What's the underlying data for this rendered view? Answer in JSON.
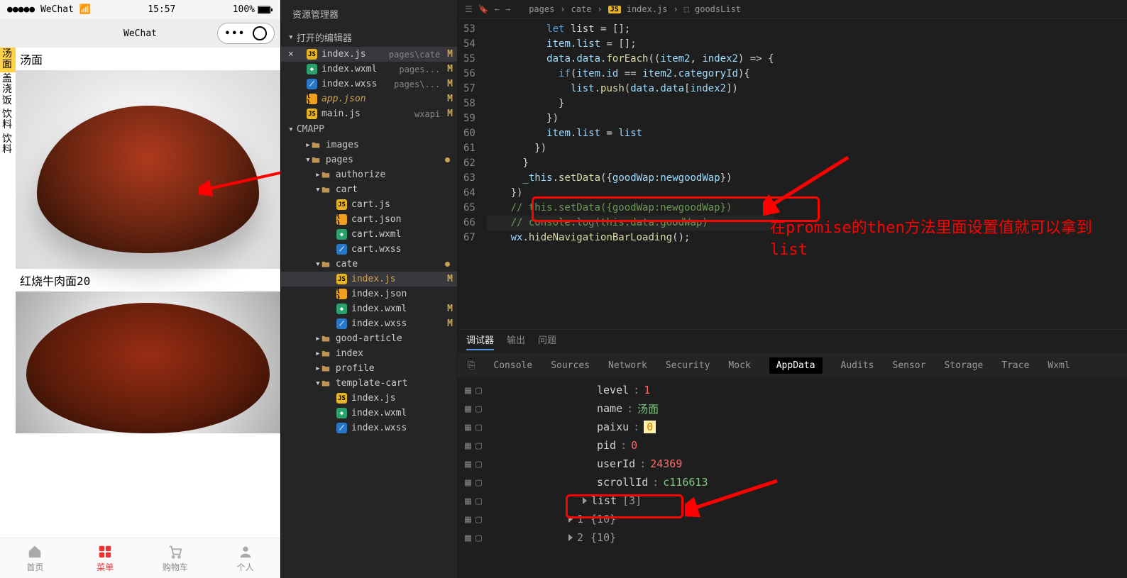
{
  "phone": {
    "carrier": "WeChat",
    "time": "15:57",
    "battery": "100%",
    "navTitle": "WeChat",
    "sideSelected": "汤面",
    "sideItems": [
      "盖浇饭",
      "饮料",
      "饮料"
    ],
    "food1": "汤面",
    "food2": "红烧牛肉面20",
    "tabs": [
      {
        "label": "首页",
        "icon": "home"
      },
      {
        "label": "菜单",
        "icon": "grid",
        "active": true
      },
      {
        "label": "购物车",
        "icon": "cart"
      },
      {
        "label": "个人",
        "icon": "user"
      }
    ]
  },
  "explorer": {
    "title": "资源管理器",
    "openEditors": "打开的编辑器",
    "openFiles": [
      {
        "name": "index.js",
        "suf": "pages\\cate",
        "mod": "M",
        "icon": "js",
        "active": true
      },
      {
        "name": "index.wxml",
        "suf": "pages...",
        "mod": "M",
        "icon": "wxml"
      },
      {
        "name": "index.wxss",
        "suf": "pages\\...",
        "mod": "M",
        "icon": "wxss"
      },
      {
        "name": "app.json",
        "suf": "",
        "mod": "M",
        "icon": "json",
        "italic": true
      },
      {
        "name": "main.js",
        "suf": "wxapi",
        "mod": "M",
        "icon": "js"
      }
    ],
    "project": "CMAPP",
    "tree": [
      {
        "type": "fold",
        "name": "images",
        "depth": 1
      },
      {
        "type": "fold",
        "name": "pages",
        "depth": 1,
        "open": true,
        "dot": true
      },
      {
        "type": "fold",
        "name": "authorize",
        "depth": 2
      },
      {
        "type": "fold",
        "name": "cart",
        "depth": 2,
        "open": true
      },
      {
        "type": "file",
        "name": "cart.js",
        "depth": 3,
        "icon": "js"
      },
      {
        "type": "file",
        "name": "cart.json",
        "depth": 3,
        "icon": "json"
      },
      {
        "type": "file",
        "name": "cart.wxml",
        "depth": 3,
        "icon": "wxml"
      },
      {
        "type": "file",
        "name": "cart.wxss",
        "depth": 3,
        "icon": "wxss"
      },
      {
        "type": "fold",
        "name": "cate",
        "depth": 2,
        "open": true,
        "dot": true
      },
      {
        "type": "file",
        "name": "index.js",
        "depth": 3,
        "icon": "js",
        "mod": "M",
        "active": true
      },
      {
        "type": "file",
        "name": "index.json",
        "depth": 3,
        "icon": "json"
      },
      {
        "type": "file",
        "name": "index.wxml",
        "depth": 3,
        "icon": "wxml",
        "mod": "M"
      },
      {
        "type": "file",
        "name": "index.wxss",
        "depth": 3,
        "icon": "wxss",
        "mod": "M"
      },
      {
        "type": "fold",
        "name": "good-article",
        "depth": 2
      },
      {
        "type": "fold",
        "name": "index",
        "depth": 2
      },
      {
        "type": "fold",
        "name": "profile",
        "depth": 2
      },
      {
        "type": "fold",
        "name": "template-cart",
        "depth": 2,
        "open": true
      },
      {
        "type": "file",
        "name": "index.js",
        "depth": 3,
        "icon": "js"
      },
      {
        "type": "file",
        "name": "index.wxml",
        "depth": 3,
        "icon": "wxml"
      },
      {
        "type": "file",
        "name": "index.wxss",
        "depth": 3,
        "icon": "wxss"
      }
    ]
  },
  "breadcrumb": [
    "pages",
    "cate",
    "index.js",
    "goodsList"
  ],
  "codeStart": 53,
  "code": [
    [
      [
        "pn",
        "          "
      ],
      [
        "k-let",
        "let"
      ],
      [
        "pn",
        " list "
      ],
      [
        "op",
        "="
      ],
      [
        "pn",
        " "
      ],
      [
        "op",
        "["
      ],
      [
        "op",
        "]"
      ],
      [
        "op",
        ";"
      ]
    ],
    [
      [
        "pn",
        "          "
      ],
      [
        "prop",
        "item"
      ],
      [
        "op",
        "."
      ],
      [
        "prop",
        "list"
      ],
      [
        "pn",
        " "
      ],
      [
        "op",
        "="
      ],
      [
        "pn",
        " "
      ],
      [
        "op",
        "["
      ],
      [
        "op",
        "]"
      ],
      [
        "op",
        ";"
      ]
    ],
    [
      [
        "pn",
        "          "
      ],
      [
        "prop",
        "data"
      ],
      [
        "op",
        "."
      ],
      [
        "prop",
        "data"
      ],
      [
        "op",
        "."
      ],
      [
        "fn",
        "forEach"
      ],
      [
        "op",
        "(("
      ],
      [
        "prop",
        "item2"
      ],
      [
        "op",
        ", "
      ],
      [
        "prop",
        "index2"
      ],
      [
        "op",
        ") "
      ],
      [
        "op",
        "=>"
      ],
      [
        "pn",
        " "
      ],
      [
        "op",
        "{"
      ]
    ],
    [
      [
        "pn",
        "            "
      ],
      [
        "k-this",
        "if"
      ],
      [
        "op",
        "("
      ],
      [
        "prop",
        "item"
      ],
      [
        "op",
        "."
      ],
      [
        "prop",
        "id"
      ],
      [
        "pn",
        " "
      ],
      [
        "op",
        "=="
      ],
      [
        "pn",
        " "
      ],
      [
        "prop",
        "item2"
      ],
      [
        "op",
        "."
      ],
      [
        "prop",
        "categoryId"
      ],
      [
        "op",
        "){"
      ]
    ],
    [
      [
        "pn",
        "              "
      ],
      [
        "prop",
        "list"
      ],
      [
        "op",
        "."
      ],
      [
        "fn",
        "push"
      ],
      [
        "op",
        "("
      ],
      [
        "prop",
        "data"
      ],
      [
        "op",
        "."
      ],
      [
        "prop",
        "data"
      ],
      [
        "op",
        "["
      ],
      [
        "prop",
        "index2"
      ],
      [
        "op",
        "])"
      ]
    ],
    [
      [
        "pn",
        "            "
      ],
      [
        "op",
        "}"
      ]
    ],
    [
      [
        "pn",
        "          "
      ],
      [
        "op",
        "})"
      ]
    ],
    [
      [
        "pn",
        "          "
      ],
      [
        "prop",
        "item"
      ],
      [
        "op",
        "."
      ],
      [
        "prop",
        "list"
      ],
      [
        "pn",
        " "
      ],
      [
        "op",
        "="
      ],
      [
        "pn",
        " "
      ],
      [
        "prop",
        "list"
      ]
    ],
    [
      [
        "pn",
        "        "
      ],
      [
        "op",
        "})"
      ]
    ],
    [
      [
        "pn",
        "      "
      ],
      [
        "op",
        "}"
      ]
    ],
    [
      [
        "pn",
        "      "
      ],
      [
        "prop",
        "_this"
      ],
      [
        "op",
        "."
      ],
      [
        "fn",
        "setData"
      ],
      [
        "op",
        "({"
      ],
      [
        "prop",
        "goodWap"
      ],
      [
        "op",
        ":"
      ],
      [
        "prop",
        "newgoodWap"
      ],
      [
        "op",
        "})"
      ]
    ],
    [
      [
        "pn",
        "    "
      ],
      [
        "op",
        "})"
      ]
    ],
    [
      [
        "pn",
        "    "
      ],
      [
        "cmt",
        "// this.setData({goodWap:newgoodWap})"
      ]
    ],
    [
      [
        "pn",
        "    "
      ],
      [
        "cmt",
        "// console.log(this.data.goodWap)"
      ]
    ],
    [
      [
        "pn",
        "    "
      ],
      [
        "prop",
        "wx"
      ],
      [
        "op",
        "."
      ],
      [
        "fn",
        "hideNavigationBarLoading"
      ],
      [
        "op",
        "();"
      ]
    ]
  ],
  "annotation": "在promise的then方法里面设置值就可以拿到list",
  "debugger": {
    "tabs": [
      "调试器",
      "输出",
      "问题"
    ],
    "active": "调试器",
    "devtabs": [
      "Console",
      "Sources",
      "Network",
      "Security",
      "Mock",
      "AppData",
      "Audits",
      "Sensor",
      "Storage",
      "Trace",
      "Wxml"
    ],
    "devActive": "AppData",
    "rows": [
      {
        "k": "level",
        "sep": ":",
        "v": "1",
        "cls": "v-num"
      },
      {
        "k": "name",
        "sep": ":",
        "v": "汤面",
        "cls": "v-str"
      },
      {
        "k": "paixu",
        "sep": ":",
        "v": "0",
        "cls": "v-hi"
      },
      {
        "k": "pid",
        "sep": ":",
        "v": "0",
        "cls": "v-num"
      },
      {
        "k": "userId",
        "sep": ":",
        "v": "24369",
        "cls": "v-num"
      },
      {
        "k": "scrollId",
        "sep": ":",
        "v": "c116613",
        "cls": "v-str"
      }
    ],
    "listLabel": "list",
    "listLen": "[3]",
    "sub": [
      {
        "i": "1",
        "v": "{10}"
      },
      {
        "i": "2",
        "v": "{10}"
      }
    ]
  }
}
